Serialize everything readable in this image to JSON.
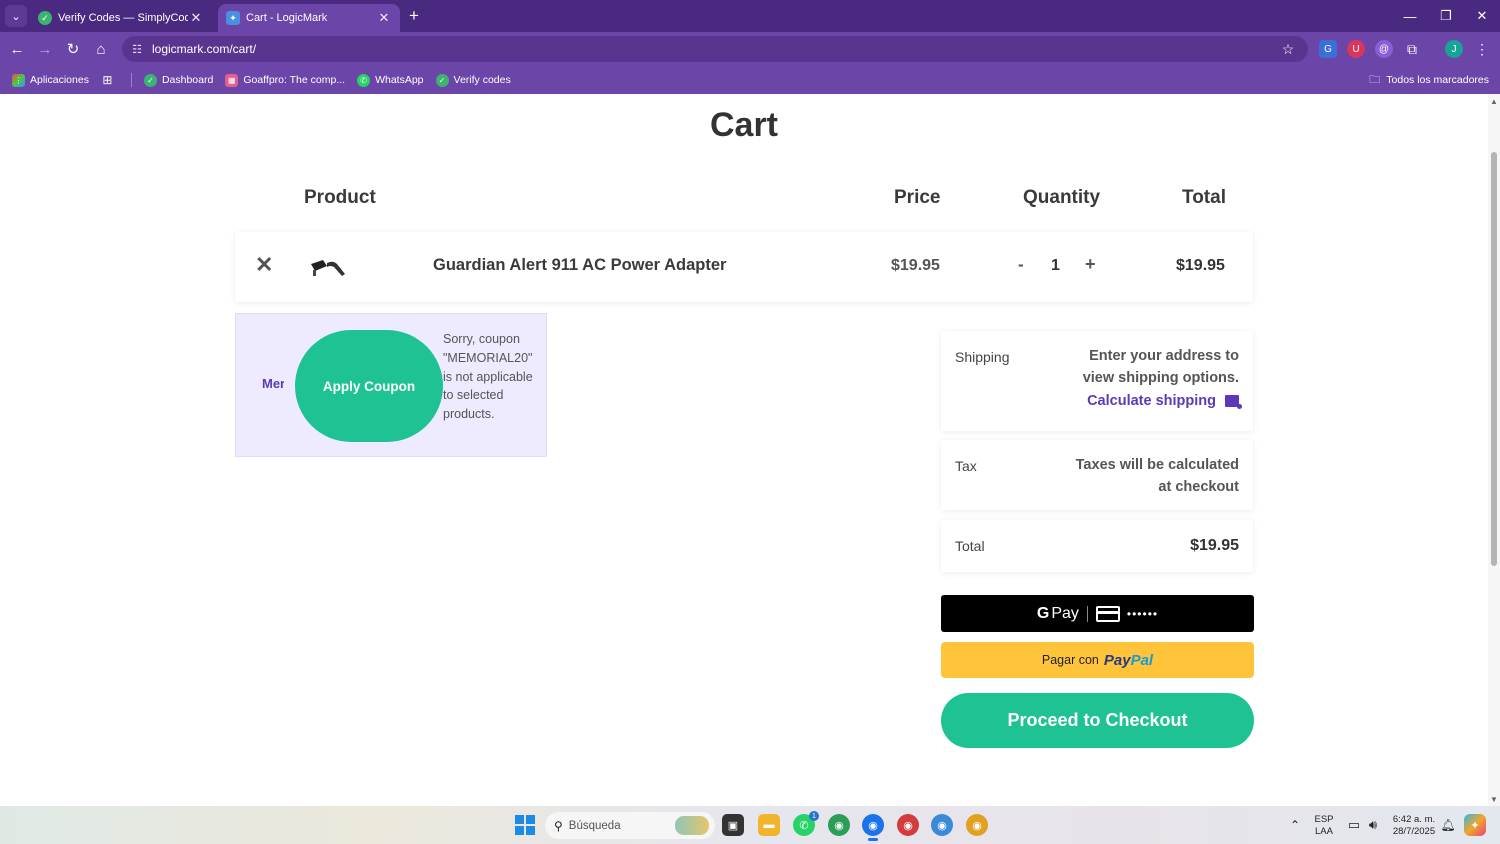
{
  "browser": {
    "tabs": [
      {
        "title": "Verify Codes — SimplyCodes",
        "active": false
      },
      {
        "title": "Cart - LogicMark",
        "active": true
      }
    ],
    "url": "logicmark.com/cart/",
    "bookmarks": [
      {
        "label": "Aplicaciones",
        "icon": "apps-grid-icon"
      },
      {
        "label": "",
        "icon": "grid-icon"
      },
      {
        "label": "Dashboard",
        "icon": "simplycodes-icon"
      },
      {
        "label": "Goaffpro: The comp...",
        "icon": "goaffpro-icon"
      },
      {
        "label": "WhatsApp",
        "icon": "whatsapp-icon"
      },
      {
        "label": "Verify codes",
        "icon": "simplycodes-icon"
      }
    ],
    "all_bookmarks": "Todos los marcadores",
    "profile_initial": "J"
  },
  "cart": {
    "title": "Cart",
    "headers": {
      "product": "Product",
      "price": "Price",
      "quantity": "Quantity",
      "total": "Total"
    },
    "item": {
      "name": "Guardian Alert 911 AC Power Adapter",
      "price": "$19.95",
      "quantity": "1",
      "total": "$19.95",
      "remove": "✕",
      "minus": "-",
      "plus": "+"
    },
    "coupon": {
      "input_value": "Mer",
      "apply_label": "Apply Coupon",
      "message": "Sorry, coupon \"MEMORIAL20\" is not applicable to selected products."
    },
    "summary": {
      "shipping_label": "Shipping",
      "shipping_value": "Enter your address to view shipping options.",
      "calculate_shipping": "Calculate shipping",
      "tax_label": "Tax",
      "tax_value": "Taxes will be calculated at checkout",
      "total_label": "Total",
      "total_value": "$19.95"
    },
    "payments": {
      "gpay_g": "G",
      "gpay_pay": "Pay",
      "gpay_dots": "••••••",
      "paypal_prefix": "Pagar con",
      "paypal_p1": "Pay",
      "paypal_p2": "Pal",
      "checkout": "Proceed to Checkout"
    }
  },
  "taskbar": {
    "search_placeholder": "Búsqueda",
    "lang": "ESP",
    "lang2": "LAA",
    "time": "6:42 a. m.",
    "date": "28/7/2025"
  },
  "colors": {
    "chrome_dark": "#4a2a80",
    "chrome": "#6b45a8",
    "accent_green": "#1ec293",
    "accent_purple": "#5a3ab5",
    "paypal_yellow": "#ffc43a"
  }
}
